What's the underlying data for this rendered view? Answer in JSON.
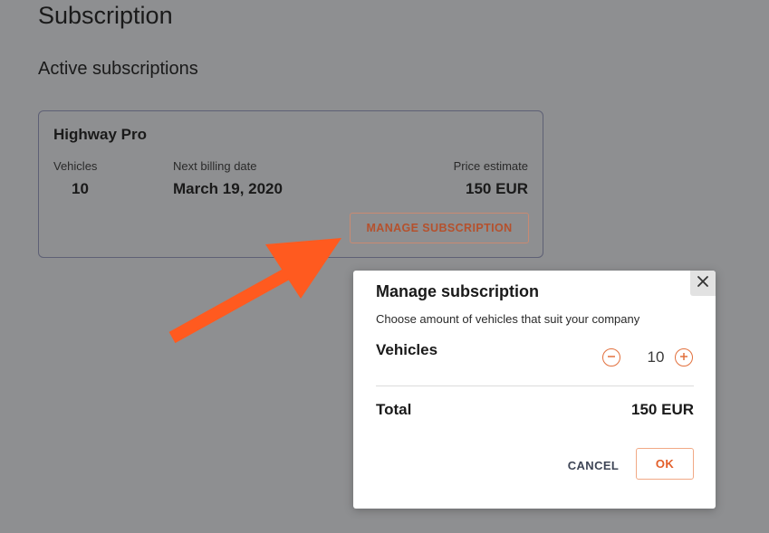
{
  "page": {
    "title": "Subscription"
  },
  "section": {
    "title": "Active subscriptions"
  },
  "subscription": {
    "name": "Highway Pro",
    "vehicles_label": "Vehicles",
    "vehicles_value": "10",
    "billing_label": "Next billing date",
    "billing_value": "March 19, 2020",
    "price_label": "Price estimate",
    "price_value": "150 EUR",
    "manage_label": "MANAGE SUBSCRIPTION"
  },
  "modal": {
    "title": "Manage subscription",
    "description": "Choose amount of vehicles that suit your company",
    "vehicles_label": "Vehicles",
    "quantity": "10",
    "total_label": "Total",
    "total_value": "150 EUR",
    "cancel_label": "CANCEL",
    "ok_label": "OK"
  },
  "icons": {
    "close": "close-icon",
    "minus": "minus-icon",
    "plus": "plus-icon",
    "arrow": "annotation-arrow"
  },
  "colors": {
    "accent": "#e2703d",
    "arrow": "#ff5a1f",
    "overlay": "#8e8f91"
  }
}
